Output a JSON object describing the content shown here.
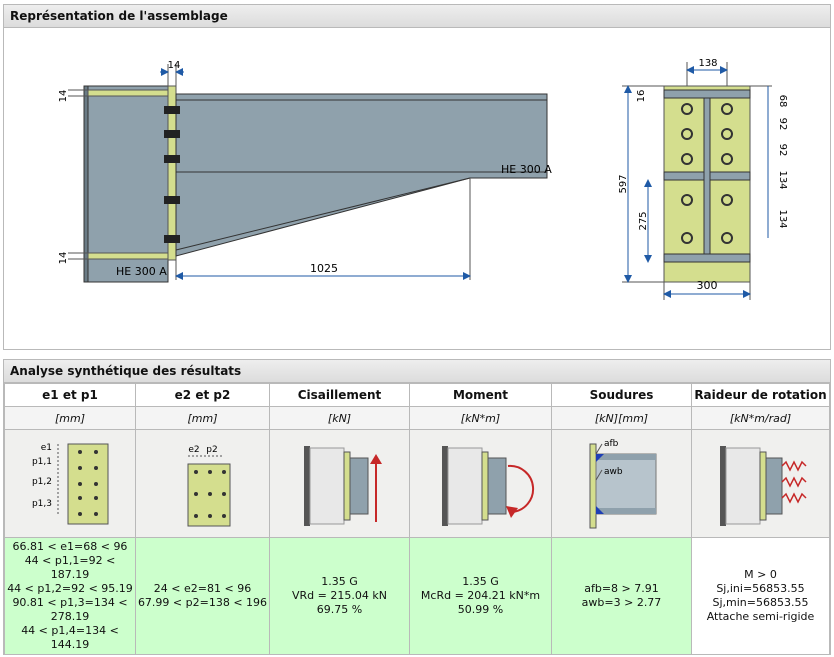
{
  "panel_drawing": {
    "title": "Représentation de l'assemblage",
    "dims": {
      "plate_thk": "14",
      "flange_top": "14",
      "flange_bot": "14",
      "haunch_len": "1025",
      "beam_label": "HE 300 A",
      "column_label": "HE 300 A",
      "plate_width_bolts": "138",
      "top_edge": "16",
      "total_height": "597",
      "lower_height": "275",
      "plate_width": "300",
      "pitch_1": "68",
      "pitch_2": "92",
      "pitch_3": "92",
      "pitch_4": "134",
      "pitch_5": "134"
    }
  },
  "panel_results": {
    "title": "Analyse synthétique des résultats",
    "columns": [
      {
        "header": "e1 et p1",
        "unit": "[mm]"
      },
      {
        "header": "e2 et p2",
        "unit": "[mm]"
      },
      {
        "header": "Cisaillement",
        "unit": "[kN]"
      },
      {
        "header": "Moment",
        "unit": "[kN*m]"
      },
      {
        "header": "Soudures",
        "unit": "[kN][mm]"
      },
      {
        "header": "Raideur de rotation",
        "unit": "[kN*m/rad]"
      }
    ],
    "icon_labels": {
      "e1": "e1",
      "p11": "p1,1",
      "p12": "p1,2",
      "p13": "p1,3",
      "e2": "e2",
      "p2": "p2",
      "afb": "afb",
      "awb": "awb"
    },
    "values": {
      "col1": [
        "66.81 < e1=68 < 96",
        "44 < p1,1=92 < 187.19",
        "44 < p1,2=92 < 95.19",
        "90.81 < p1,3=134 <",
        "278.19",
        "44 < p1,4=134 <",
        "144.19"
      ],
      "col2": [
        "24 < e2=81 < 96",
        "67.99 < p2=138 < 196"
      ],
      "col3": [
        "1.35 G",
        "VRd = 215.04 kN",
        "69.75 %"
      ],
      "col4": [
        "1.35 G",
        "McRd = 204.21 kN*m",
        "50.99 %"
      ],
      "col5": [
        "afb=8 > 7.91",
        "awb=3 > 2.77"
      ],
      "col6": [
        "M > 0",
        "Sj,ini=56853.55",
        "Sj,min=56853.55",
        "Attache semi-rigide"
      ]
    }
  },
  "colors": {
    "steel": "#8fa1ac",
    "plate": "#d4de8e",
    "dim": "#1f5aa6",
    "ok": "#ccffcc"
  }
}
